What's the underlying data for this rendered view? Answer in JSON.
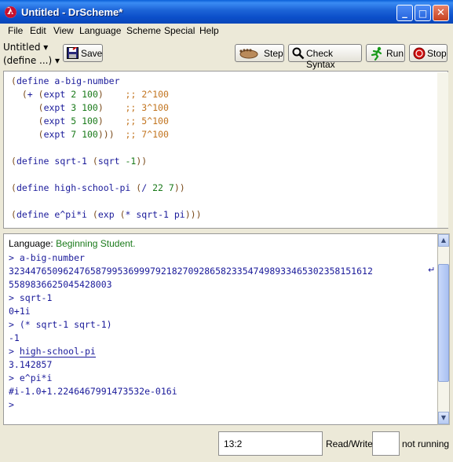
{
  "window": {
    "title": "Untitled - DrScheme*",
    "controls": {
      "minimize": "_",
      "maximize": "□",
      "close": "✕"
    }
  },
  "menubar": {
    "items": [
      "File",
      "Edit",
      "View",
      "Language",
      "Scheme",
      "Special",
      "Help"
    ]
  },
  "toolbar": {
    "file_popup": "Untitled ▾",
    "define_popup": "(define ...) ▾",
    "save_label": "Save",
    "step_label": "Step",
    "check_syntax_label": "Check Syntax",
    "run_label": "Run",
    "stop_label": "Stop"
  },
  "editor": {
    "lines": [
      {
        "prefix": "(define a-big-number",
        "comment": ""
      },
      {
        "prefix": "  (+ (expt 2 100)    ",
        "comment": ";; 2^100"
      },
      {
        "prefix": "     (expt 3 100)    ",
        "comment": ";; 3^100"
      },
      {
        "prefix": "     (expt 5 100)    ",
        "comment": ";; 5^100"
      },
      {
        "prefix": "     (expt 7 100)))  ",
        "comment": ";; 7^100"
      },
      {
        "prefix": "",
        "comment": ""
      },
      {
        "prefix": "(define sqrt-1 (sqrt -1))",
        "comment": ""
      },
      {
        "prefix": "",
        "comment": ""
      },
      {
        "prefix": "(define high-school-pi (/ 22 7))",
        "comment": ""
      },
      {
        "prefix": "",
        "comment": ""
      },
      {
        "prefix": "(define e^pi*i (exp (* sqrt-1 pi)))",
        "comment": ""
      }
    ]
  },
  "interactions": {
    "language_label": "Language: ",
    "language_name": "Beginning Student.",
    "lines": [
      "> a-big-number",
      "3234476509624765879953699979218270928658233547498933465302358151612",
      "5589836625045428003",
      "> sqrt-1",
      "0+1i",
      "> (* sqrt-1 sqrt-1)",
      "-1",
      "> high-school-pi",
      "3.142857",
      "> e^pi*i",
      "#i-1.0+1.2246467991473532e-016i",
      ">"
    ]
  },
  "statusbar": {
    "position": "13:2",
    "mode": "Read/Write",
    "status": "not running"
  },
  "colors": {
    "titlebar": "#0b4ec9",
    "code_paren": "#7a4a1a",
    "code_symbol": "#1a1a9a",
    "code_number": "#1a7a1a",
    "comment": "#c2741f",
    "language_name": "#1a7a1a"
  }
}
